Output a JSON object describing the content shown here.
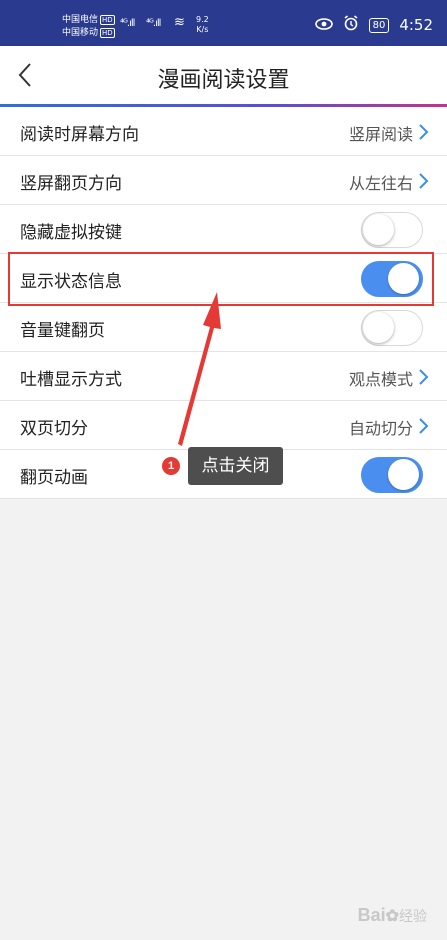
{
  "status_bar": {
    "carrier1": "中国电信",
    "carrier2": "中国移动",
    "hd": "HD",
    "speed_value": "9.2",
    "speed_unit": "K/s",
    "battery": "80",
    "time": "4:52"
  },
  "header": {
    "title": "漫画阅读设置"
  },
  "settings": [
    {
      "label": "阅读时屏幕方向",
      "value": "竖屏阅读"
    },
    {
      "label": "竖屏翻页方向",
      "value": "从左往右"
    },
    {
      "label": "隐藏虚拟按键",
      "toggle": false
    },
    {
      "label": "显示状态信息",
      "toggle": true
    },
    {
      "label": "音量键翻页",
      "toggle": false
    },
    {
      "label": "吐槽显示方式",
      "value": "观点模式"
    },
    {
      "label": "双页切分",
      "value": "自动切分"
    },
    {
      "label": "翻页动画",
      "toggle": true
    }
  ],
  "annotation": {
    "step": "1",
    "text": "点击关闭",
    "color": "#e53935"
  },
  "watermark": {
    "brand": "Bai",
    "suffix": "经验"
  },
  "colors": {
    "status_bar": "#2a3a8e",
    "toggle_on": "#4a8ef0",
    "accent_start": "#2f6fd8",
    "accent_end": "#c2338f"
  }
}
